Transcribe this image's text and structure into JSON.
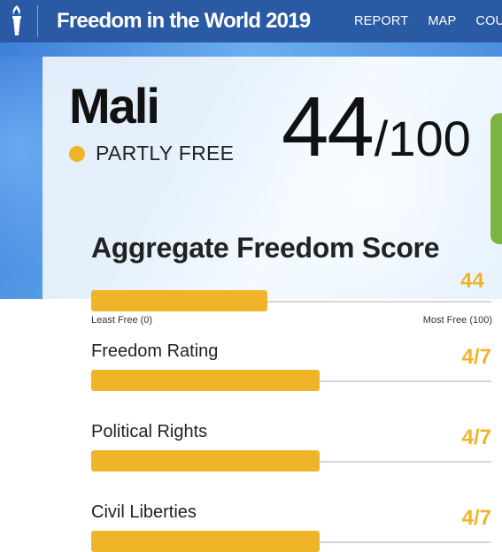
{
  "header": {
    "site_title": "Freedom in the World 2019",
    "nav": [
      "REPORT",
      "MAP",
      "COU"
    ],
    "logo_icon": "torch-icon",
    "color": "#2a5aa3"
  },
  "country": {
    "name": "Mali",
    "status": "PARTLY FREE",
    "status_color": "#f0b429",
    "score": "44",
    "score_max": "/100"
  },
  "aggregate": {
    "title": "Aggregate Freedom Score",
    "value": "44",
    "fraction": 0.44,
    "least_label": "Least Free (0)",
    "most_label": "Most Free (100)"
  },
  "ratings": [
    {
      "label": "Freedom Rating",
      "value": "4/7",
      "fraction": 0.571
    },
    {
      "label": "Political Rights",
      "value": "4/7",
      "fraction": 0.571
    },
    {
      "label": "Civil Liberties",
      "value": "4/7",
      "fraction": 0.571
    }
  ],
  "colors": {
    "accent": "#f0b429",
    "track": "#d6d6d6"
  }
}
